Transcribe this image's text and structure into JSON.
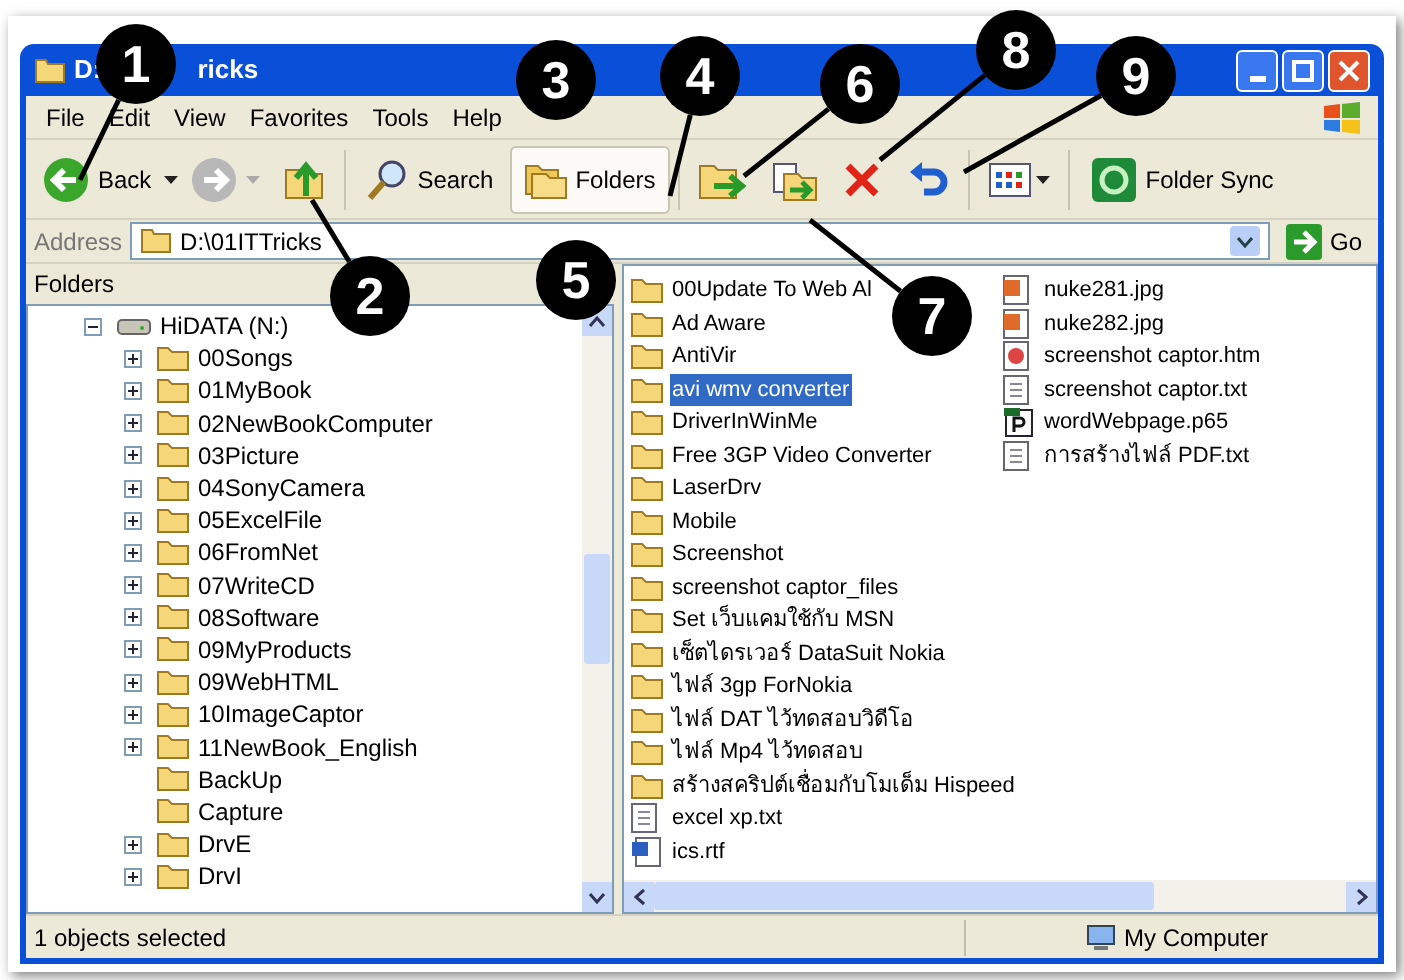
{
  "window": {
    "title_start": "D:",
    "title_end": "ricks"
  },
  "menu": [
    "File",
    "Edit",
    "View",
    "Favorites",
    "Tools",
    "Help"
  ],
  "toolbar": [
    {
      "kind": "back",
      "label": "Back"
    },
    {
      "kind": "forward"
    },
    {
      "kind": "up"
    },
    {
      "kind": "search",
      "label": "Search"
    },
    {
      "kind": "folders",
      "label": "Folders",
      "selected": true
    },
    {
      "kind": "move"
    },
    {
      "kind": "copy"
    },
    {
      "kind": "delete"
    },
    {
      "kind": "undo"
    },
    {
      "kind": "views"
    },
    {
      "kind": "sync",
      "label": "Folder Sync"
    }
  ],
  "address": {
    "label": "Address",
    "value": "D:\\01ITTricks",
    "go": "Go"
  },
  "folders_pane": {
    "title": "Folders",
    "tree": [
      {
        "label": "HiDATA (N:)",
        "expanded": true,
        "children": [
          {
            "label": "00Songs",
            "expanded": false
          },
          {
            "label": "01MyBook",
            "expanded": false
          },
          {
            "label": "02NewBookComputer",
            "expanded": false
          },
          {
            "label": "03Picture",
            "expanded": false
          },
          {
            "label": "04SonyCamera",
            "expanded": false
          },
          {
            "label": "05ExcelFile",
            "expanded": false
          },
          {
            "label": "06FromNet",
            "expanded": false
          },
          {
            "label": "07WriteCD",
            "expanded": false
          },
          {
            "label": "08Software",
            "expanded": false
          },
          {
            "label": "09MyProducts",
            "expanded": false
          },
          {
            "label": "09WebHTML",
            "expanded": false
          },
          {
            "label": "10ImageCaptor",
            "expanded": false
          },
          {
            "label": "11NewBook_English",
            "expanded": false
          },
          {
            "label": "BackUp"
          },
          {
            "label": "Capture"
          },
          {
            "label": "DrvE",
            "expanded": false
          },
          {
            "label": "DrvI",
            "expanded": false
          }
        ]
      }
    ]
  },
  "files": [
    {
      "kind": "folder",
      "name": "00Update To Web Al",
      "selected": false
    },
    {
      "kind": "folder",
      "name": "Ad Aware",
      "selected": false
    },
    {
      "kind": "folder",
      "name": "AntiVir",
      "selected": false
    },
    {
      "kind": "folder",
      "name": "avi wmv converter",
      "selected": true
    },
    {
      "kind": "folder",
      "name": "DriverInWinMe",
      "selected": false
    },
    {
      "kind": "folder",
      "name": "Free 3GP Video Converter",
      "selected": false
    },
    {
      "kind": "folder",
      "name": "LaserDrv",
      "selected": false
    },
    {
      "kind": "folder",
      "name": "Mobile",
      "selected": false
    },
    {
      "kind": "folder",
      "name": "Screenshot",
      "selected": false
    },
    {
      "kind": "folder",
      "name": "screenshot captor_files",
      "selected": false
    },
    {
      "kind": "folder",
      "name": "Set เว็บแคมใช้กับ MSN",
      "selected": false
    },
    {
      "kind": "folder",
      "name": "เซ็ตไดรเวอร์ DataSuit Nokia",
      "selected": false
    },
    {
      "kind": "folder",
      "name": "ไฟล์ 3gp ForNokia",
      "selected": false
    },
    {
      "kind": "folder",
      "name": "ไฟล์ DAT ไว้ทดสอบวิดีโอ",
      "selected": false
    },
    {
      "kind": "folder",
      "name": "ไฟล์ Mp4 ไว้ทดสอบ",
      "selected": false
    },
    {
      "kind": "folder",
      "name": "สร้างสคริปต์เชื่อมกับโมเด็ม Hispeed",
      "selected": false
    },
    {
      "kind": "text",
      "name": "excel xp.txt",
      "selected": false
    },
    {
      "kind": "document",
      "name": "ics.rtf",
      "selected": false
    },
    {
      "kind": "image",
      "name": "nuke281.jpg",
      "selected": false
    },
    {
      "kind": "image",
      "name": "nuke282.jpg",
      "selected": false
    },
    {
      "kind": "webpage",
      "name": "screenshot captor.htm",
      "selected": false
    },
    {
      "kind": "text",
      "name": "screenshot captor.txt",
      "selected": false
    },
    {
      "kind": "publisher",
      "name": "wordWebpage.p65",
      "selected": false
    },
    {
      "kind": "text",
      "name": "การสร้างไฟล์ PDF.txt",
      "selected": false
    }
  ],
  "status_bar": [
    "1 objects selected",
    "My Computer"
  ],
  "callouts": [
    "1",
    "3",
    "4",
    "6",
    "8",
    "9",
    "2",
    "5",
    "7"
  ]
}
